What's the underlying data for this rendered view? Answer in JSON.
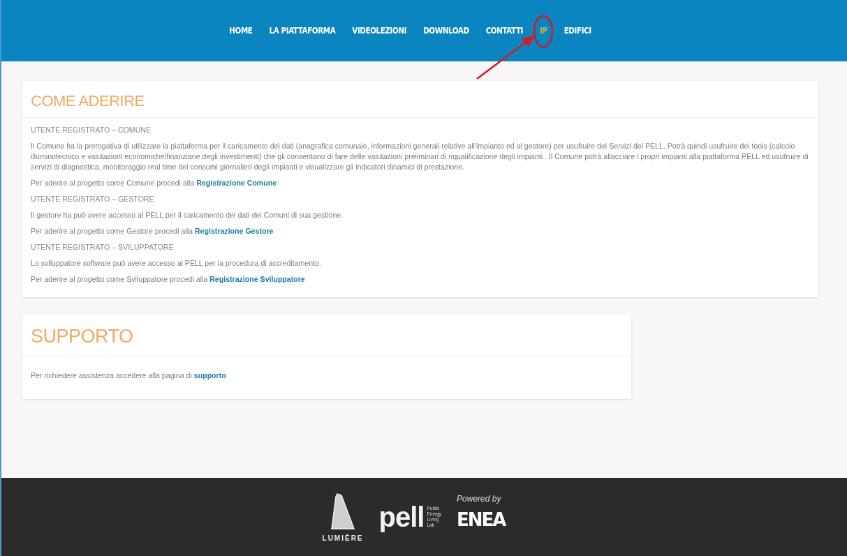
{
  "nav": [
    {
      "label": "HOME",
      "selected": false,
      "annotated": false
    },
    {
      "label": "LA PIATTAFORMA",
      "selected": false,
      "annotated": false
    },
    {
      "label": "VIDEOLEZIONI",
      "selected": false,
      "annotated": false
    },
    {
      "label": "DOWNLOAD",
      "selected": false,
      "annotated": false
    },
    {
      "label": "CONTATTI",
      "selected": false,
      "annotated": false
    },
    {
      "label": "IP",
      "selected": true,
      "annotated": true
    },
    {
      "label": "EDIFICI",
      "selected": false,
      "annotated": false
    }
  ],
  "cards": [
    {
      "title": "COME ADERIRE",
      "wide": true,
      "paragraphs": [
        {
          "kind": "heading",
          "text": "UTENTE REGISTRATO – COMUNE"
        },
        {
          "kind": "text",
          "text": "Il Comune ha la prerogativa di utilizzare la piattaforma per il caricamento dei dati (anagrafica comunale, informazioni generali relative all'impianto ed al gestore) per usufruire dei Servizi del PELL. Potrà quindi usufruire dei tools (calcolo illuminotecnico e valutazioni economiche/finanziarie degli investimenti) che gli consentano di fare delle valutazioni preliminari di riqualificazione degli impianti . Il Comune potrà allacciare i propri impianti alla piattaforma PELL ed usufruire di servizi di diagnostica, monitoraggio real time dei consumi giornalieri degli impianti e visualizzare gli indicatori dinamici di prestazione."
        },
        {
          "kind": "action",
          "text": "Per aderire al progetto come Comune procedi alla",
          "link": "Registrazione Comune"
        },
        {
          "kind": "heading",
          "text": "UTENTE REGISTRATO – GESTORE"
        },
        {
          "kind": "text",
          "text": "Il gestore ha può avere accesso al PELL per il caricamento dei dati dei Comuni di sua gestione."
        },
        {
          "kind": "action",
          "text": "Per aderire al progetto come Gestore procedi alla",
          "link": "Registrazione Gestore"
        },
        {
          "kind": "heading",
          "text": "UTENTE REGISTRATO – SVILUPPATORE"
        },
        {
          "kind": "text",
          "text": "Lo sviluppatore software può avere accesso al PELL per la procedura di accreditamento."
        },
        {
          "kind": "action",
          "text": "Per aderire al progetto come Sviluppatore procedi alla",
          "link": "Registrazione Sviluppatore"
        }
      ]
    },
    {
      "title": "SUPPORTO",
      "wide": false,
      "paragraphs": [
        {
          "kind": "action",
          "text": "Per richiedere assistenza accedere alla pagina di",
          "link": "supporto"
        }
      ]
    }
  ],
  "footer": {
    "lumiere": "LUMIÈRE",
    "pell": "pell",
    "pell_tagline": [
      "Public",
      "Energy",
      "Living",
      "Lab"
    ],
    "powered_by": "Powered by",
    "enea": "ENEA"
  }
}
